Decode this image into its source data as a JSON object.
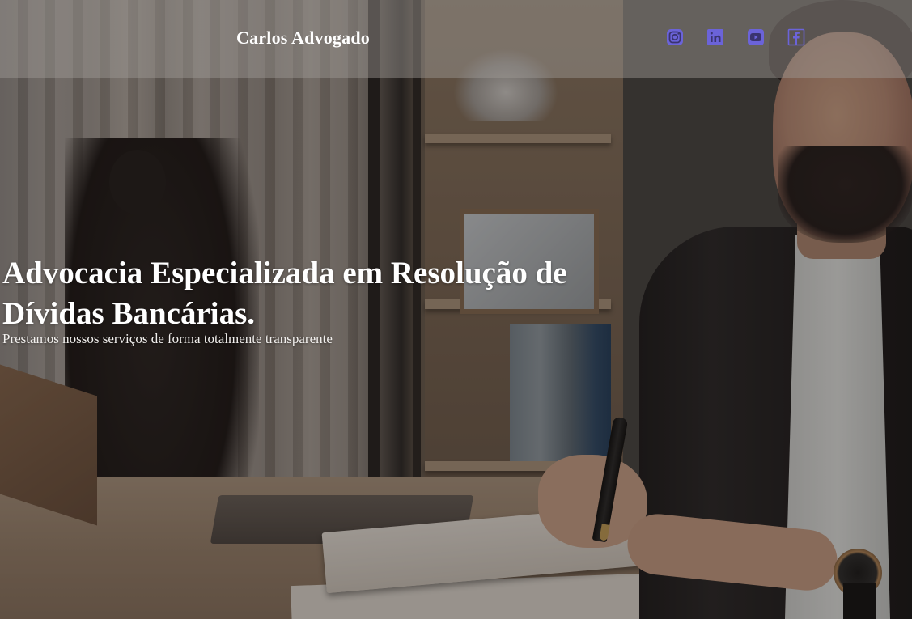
{
  "header": {
    "brand": "Carlos Advogado",
    "social_links": [
      {
        "icon": "instagram-icon",
        "color": "#6b63d9"
      },
      {
        "icon": "linkedin-icon",
        "color": "#6b63d9"
      },
      {
        "icon": "youtube-icon",
        "color": "#6b63d9"
      },
      {
        "icon": "facebook-icon",
        "color": "#6b63d9"
      }
    ]
  },
  "hero": {
    "title": "Advocacia Especializada em Resolução de Dívidas Bancárias.",
    "subtitle": "Prestamos nossos serviços de forma totalmente transparente"
  },
  "colors": {
    "accent": "#6b63d9",
    "text": "#ffffff"
  }
}
